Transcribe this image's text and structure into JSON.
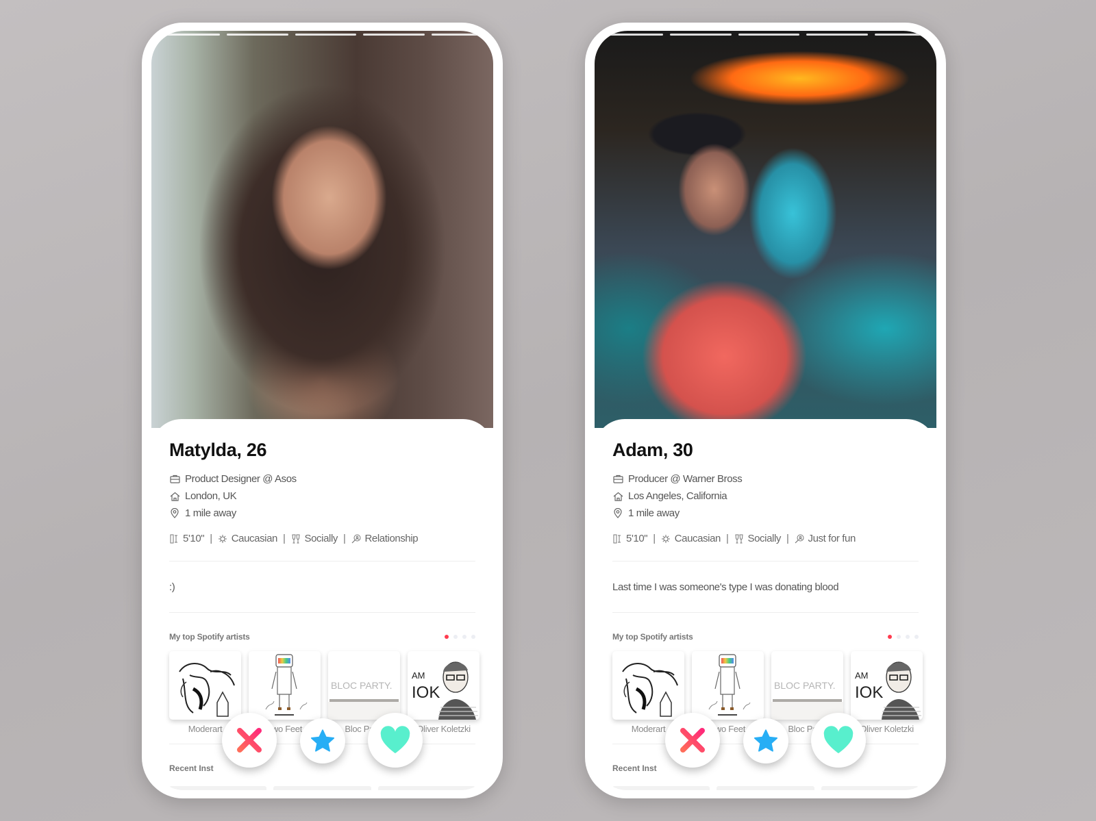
{
  "colors": {
    "nope": "#ff4f6d",
    "super": "#27aef5",
    "like": "#58efcd",
    "dot_active": "#ff3b4f"
  },
  "profiles": [
    {
      "photo_segments": 5,
      "name": "Matylda, 26",
      "job": "Product Designer @ Asos",
      "home": "London, UK",
      "distance": "1 mile away",
      "traits": {
        "height": "5'10\"",
        "ethnicity": "Caucasian",
        "drinking": "Socially",
        "looking_for": "Relationship"
      },
      "separator": "|",
      "bio": ":)",
      "spotify_title": "My top Spotify artists",
      "spotify_pages": 4,
      "spotify_active_page": 1,
      "artists": [
        {
          "name": "Moderart"
        },
        {
          "name": "Two Feet"
        },
        {
          "name": "Bloc Party",
          "cover_text": "BLOC PARTY."
        },
        {
          "name": "Oliver Koletzki",
          "cover_text": "I AM OK"
        }
      ],
      "instagram_title": "Recent Inst",
      "actions": {
        "nope": "nope-icon",
        "super": "star-icon",
        "like": "heart-icon"
      }
    },
    {
      "photo_segments": 5,
      "name": "Adam, 30",
      "job": "Producer @ Warner Bross",
      "home": "Los Angeles, California",
      "distance": "1 mile away",
      "traits": {
        "height": "5'10\"",
        "ethnicity": "Caucasian",
        "drinking": "Socially",
        "looking_for": "Just for fun"
      },
      "separator": "|",
      "bio": "Last time I was someone's type I was donating blood",
      "spotify_title": "My top Spotify artists",
      "spotify_pages": 4,
      "spotify_active_page": 1,
      "artists": [
        {
          "name": "Moderart"
        },
        {
          "name": "Two Feet"
        },
        {
          "name": "Bloc Party",
          "cover_text": "BLOC PARTY."
        },
        {
          "name": "Oliver Koletzki",
          "cover_text": "I AM OK"
        }
      ],
      "instagram_title": "Recent Inst",
      "actions": {
        "nope": "nope-icon",
        "super": "star-icon",
        "like": "heart-icon"
      }
    }
  ]
}
